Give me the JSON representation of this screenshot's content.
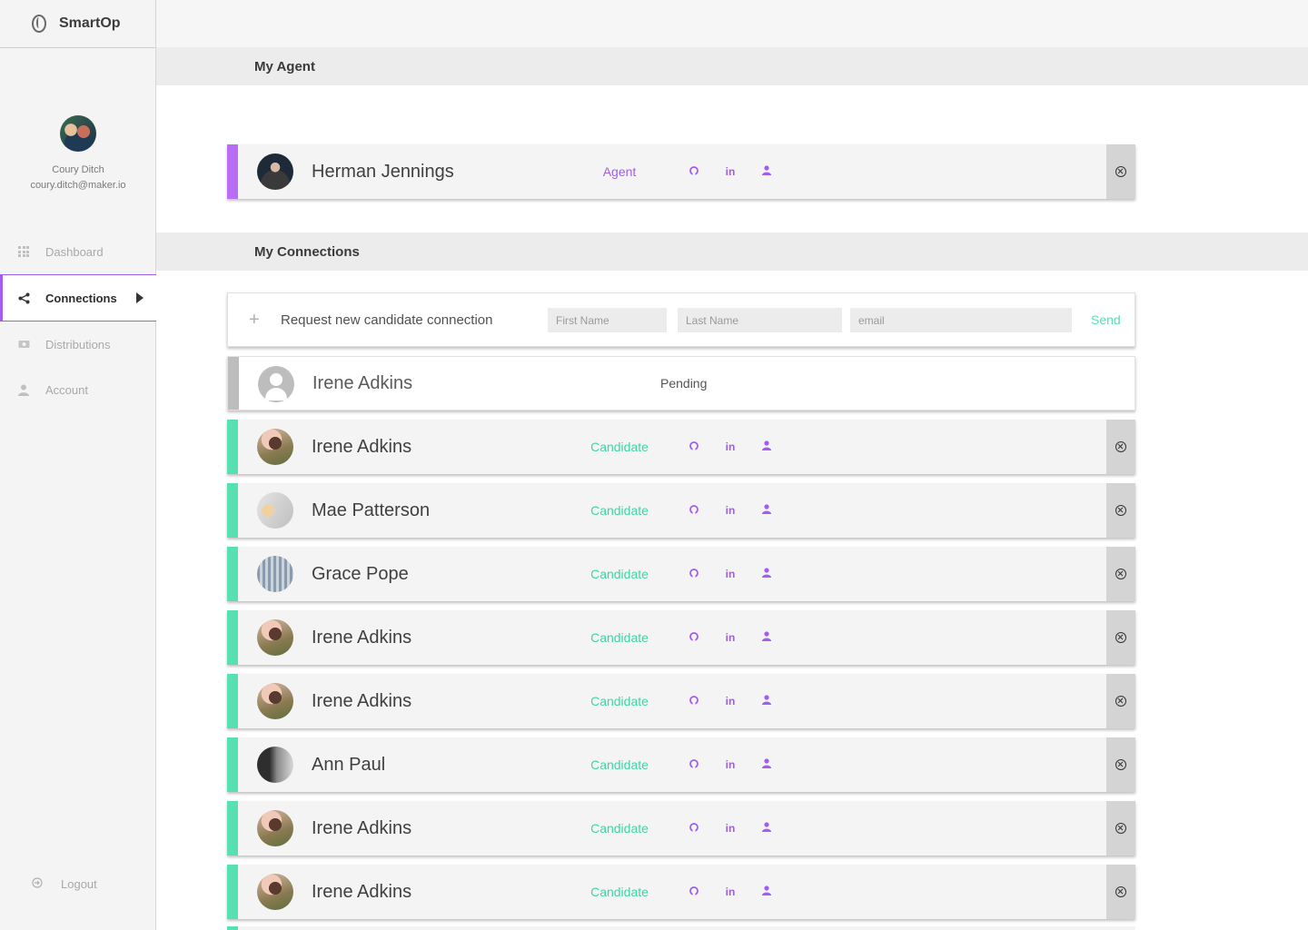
{
  "brand": {
    "name": "SmartOp",
    "logo_icon": "smartop-logo-icon"
  },
  "profile": {
    "name": "Coury Ditch",
    "email": "coury.ditch@maker.io"
  },
  "nav": {
    "items": [
      {
        "label": "Dashboard",
        "icon": "grid-icon",
        "active": false
      },
      {
        "label": "Connections",
        "icon": "share-icon",
        "active": true
      },
      {
        "label": "Distributions",
        "icon": "money-icon",
        "active": false
      },
      {
        "label": "Account",
        "icon": "person-icon",
        "active": false
      }
    ],
    "logout": "Logout"
  },
  "sections": {
    "agent": "My Agent",
    "connections": "My Connections"
  },
  "agent": {
    "name": "Herman Jennings",
    "role": "Agent"
  },
  "request": {
    "label": "Request new candidate connection",
    "first_name_placeholder": "First Name",
    "last_name_placeholder": "Last Name",
    "email_placeholder": "email",
    "send_label": "Send"
  },
  "pending": {
    "name": "Irene Adkins",
    "status": "Pending"
  },
  "link_icons": {
    "github": "github-icon",
    "linkedin": "in",
    "profile": "person-icon"
  },
  "connections": [
    {
      "name": "Irene Adkins",
      "role": "Candidate"
    },
    {
      "name": "Mae Patterson",
      "role": "Candidate"
    },
    {
      "name": "Grace Pope",
      "role": "Candidate"
    },
    {
      "name": "Irene Adkins",
      "role": "Candidate"
    },
    {
      "name": "Irene Adkins",
      "role": "Candidate"
    },
    {
      "name": "Ann Paul",
      "role": "Candidate"
    },
    {
      "name": "Irene Adkins",
      "role": "Candidate"
    },
    {
      "name": "Irene Adkins",
      "role": "Candidate"
    }
  ],
  "colors": {
    "accent": "#a35bf0",
    "candidate": "#57e0b4",
    "agent_stripe": "#b86df4",
    "pending_stripe": "#bdbdbd"
  }
}
